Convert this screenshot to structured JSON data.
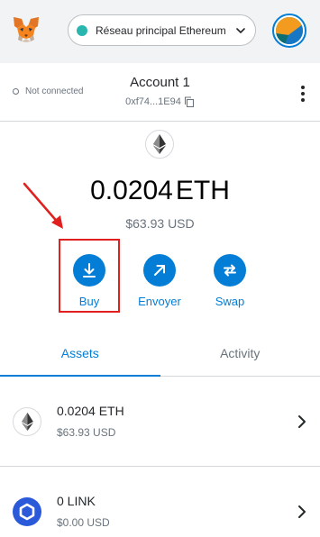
{
  "header": {
    "logo_icon": "metamask-fox-icon",
    "network": {
      "label": "Réseau principal Ethereum",
      "dot_color": "#29b6af"
    },
    "avatar_icon": "account-identicon"
  },
  "account": {
    "connection_status": "Not connected",
    "name": "Account 1",
    "address": "0xf74...1E94",
    "copy_icon": "copy-icon",
    "menu_icon": "kebab-menu-icon"
  },
  "balance": {
    "token_icon": "ethereum-icon",
    "amount": "0.0204",
    "symbol": "ETH",
    "fiat": "$63.93 USD"
  },
  "actions": [
    {
      "label": "Buy",
      "icon": "download-icon"
    },
    {
      "label": "Envoyer",
      "icon": "arrow-up-right-icon"
    },
    {
      "label": "Swap",
      "icon": "swap-arrows-icon"
    }
  ],
  "tabs": [
    {
      "label": "Assets",
      "active": true
    },
    {
      "label": "Activity",
      "active": false
    }
  ],
  "assets": [
    {
      "name": "0.0204 ETH",
      "fiat": "$63.93 USD",
      "icon": "ethereum-icon"
    },
    {
      "name": "0 LINK",
      "fiat": "$0.00 USD",
      "icon": "chainlink-icon"
    }
  ],
  "colors": {
    "accent": "#037dd6",
    "header_bg": "#f2f3f4",
    "annotation_red": "#e0201f"
  }
}
